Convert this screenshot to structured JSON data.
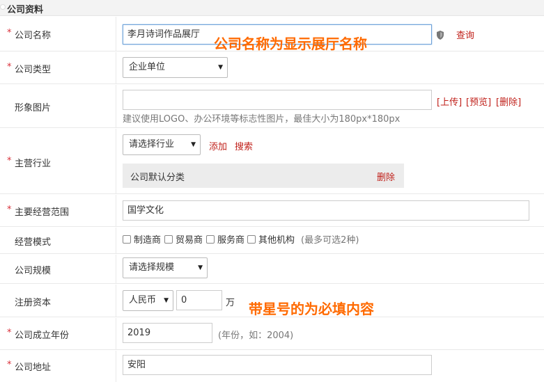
{
  "section": {
    "title": "公司资料"
  },
  "required_mark": "*",
  "company_name": {
    "label": "公司名称",
    "value": "李月诗词作品展厅",
    "query_link": "查询",
    "annotation": "公司名称为显示展厅名称"
  },
  "company_type": {
    "label": "公司类型",
    "selected": "企业单位"
  },
  "image": {
    "label": "形象图片",
    "value": "",
    "upload": "[上传]",
    "preview": "[预览]",
    "delete": "[删除]",
    "hint": "建议使用LOGO、办公环境等标志性图片，最佳大小为180px*180px"
  },
  "industry": {
    "label": "主营行业",
    "selected": "请选择行业",
    "add": "添加",
    "search": "搜索",
    "default_category": "公司默认分类",
    "delete": "删除"
  },
  "business_scope": {
    "label": "主要经营范围",
    "value": "国学文化"
  },
  "business_mode": {
    "label": "经营模式",
    "options": [
      "制造商",
      "贸易商",
      "服务商",
      "其他机构"
    ],
    "checked": [
      false,
      false,
      false,
      false
    ],
    "note": "(最多可选2种)"
  },
  "company_size": {
    "label": "公司规模",
    "selected": "请选择规模"
  },
  "capital": {
    "label": "注册资本",
    "currency": "人民币",
    "amount": "0",
    "unit": "万",
    "annotation": "带星号的为必填内容"
  },
  "founded": {
    "label": "公司成立年份",
    "value": "2019",
    "hint": "(年份，如：2004)"
  },
  "address": {
    "label": "公司地址",
    "value": "安阳"
  },
  "icons": {
    "shield": "shield-icon",
    "select_arrow": "▼"
  },
  "colors": {
    "required": "#d9303a",
    "link": "#c0211b",
    "annotation": "#ff6a00"
  }
}
